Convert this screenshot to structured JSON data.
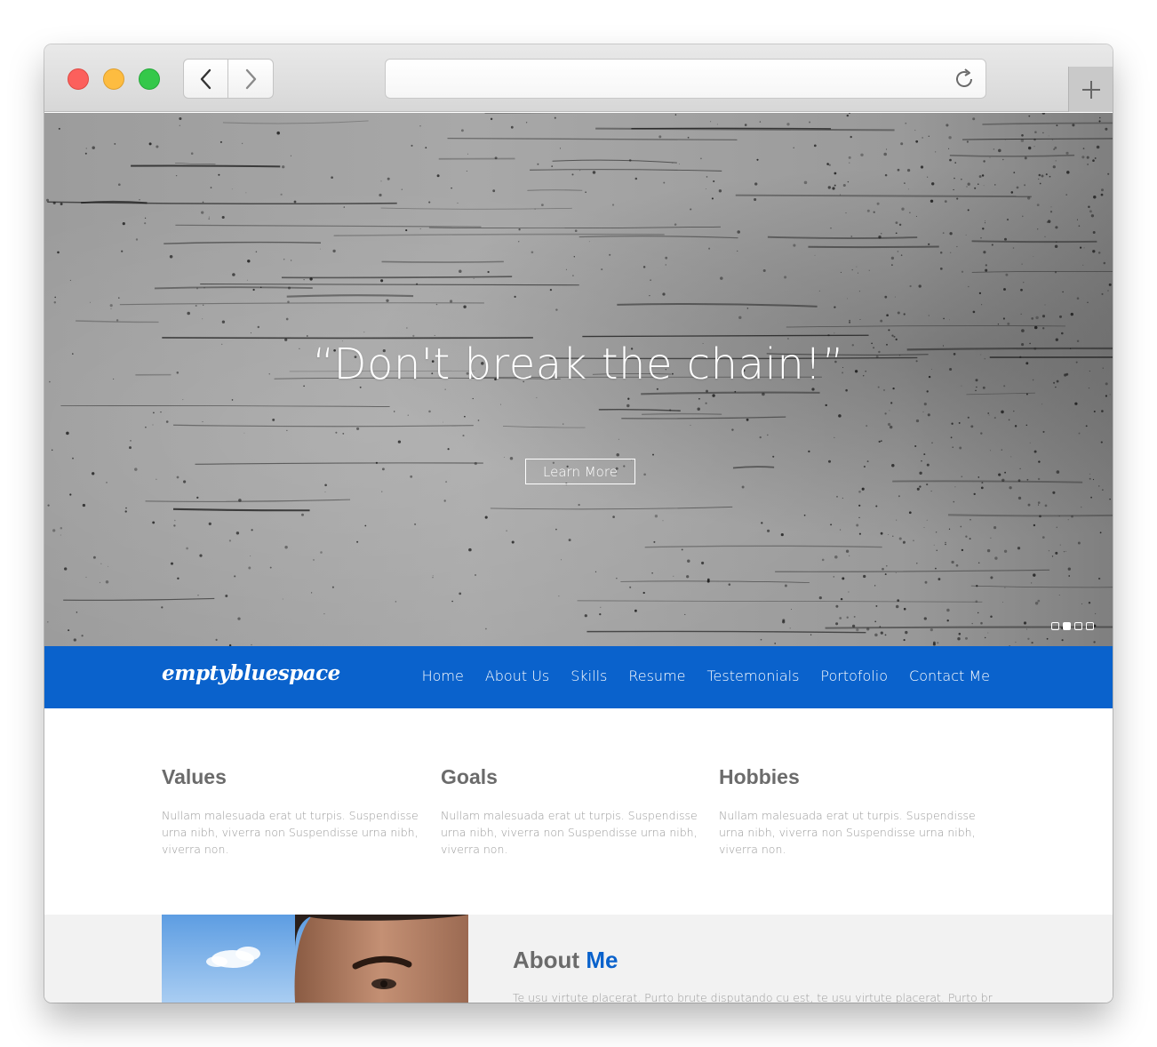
{
  "browser": {
    "url": "",
    "controls": {
      "back": "chevron-left-icon",
      "forward": "chevron-right-icon",
      "reload": "reload-icon",
      "new_tab": "plus-icon"
    }
  },
  "hero": {
    "quote": "“Don't break the chain!”",
    "button_label": "Learn More",
    "slides": 4,
    "active_slide": 2
  },
  "nav": {
    "brand": "emptybluespace",
    "items": [
      "Home",
      "About Us",
      "Skills",
      "Resume",
      "Testemonials",
      "Portofolio",
      "Contact Me"
    ]
  },
  "features": [
    {
      "title": "Values",
      "text": "Nullam malesuada erat ut turpis. Suspendisse urna nibh, viverra non Suspendisse urna nibh, viverra non."
    },
    {
      "title": "Goals",
      "text": "Nullam malesuada erat ut turpis. Suspendisse urna nibh, viverra non Suspendisse urna nibh, viverra non."
    },
    {
      "title": "Hobbies",
      "text": "Nullam malesuada erat ut turpis. Suspendisse urna nibh, viverra non Suspendisse urna nibh, viverra non."
    }
  ],
  "about": {
    "title_plain": "About",
    "title_accent": "Me",
    "text": "Te usu virtute placerat. Purto brute disputando cu est, te usu virtute placerat. Purto brute"
  },
  "colors": {
    "accent": "#0a62cc",
    "heading": "#6b6b6b",
    "body_text": "#9a9a9a",
    "about_bg": "#f2f2f2"
  }
}
